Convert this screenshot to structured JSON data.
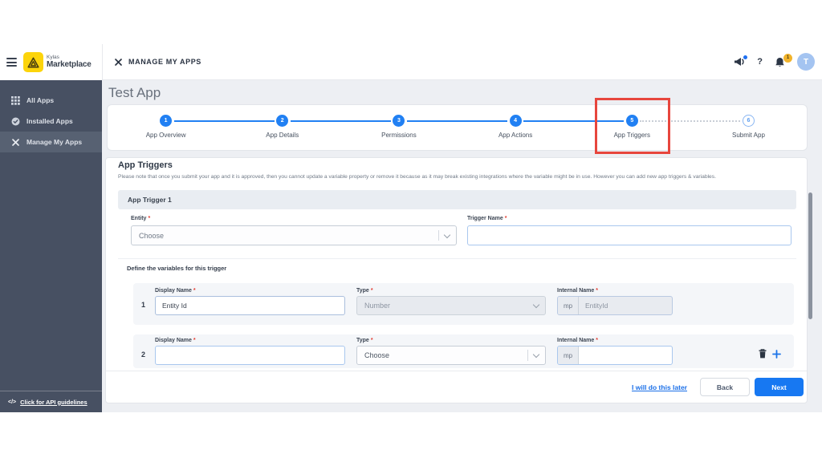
{
  "colors": {
    "accent_blue": "#2180f3",
    "button_blue": "#1778f2",
    "annotation_red": "#e7463d",
    "logo_yellow": "#fcd40b",
    "badge_yellow": "#f1b32b",
    "sidebar_bg": "#475062"
  },
  "sidebar": {
    "brand_top": "Kylas",
    "brand_bottom": "Marketplace",
    "items": [
      {
        "label": "All Apps"
      },
      {
        "label": "Installed Apps"
      },
      {
        "label": "Manage My Apps"
      }
    ],
    "api_link_icon": "</>",
    "api_link_label": "Click for API guidelines"
  },
  "topbar": {
    "title": "MANAGE MY APPS",
    "help_icon": "?",
    "notification_count": "1",
    "avatar_initial": "T"
  },
  "page": {
    "title": "Test App"
  },
  "stepper": {
    "steps": [
      {
        "number": "1",
        "label": "App Overview",
        "state": "complete"
      },
      {
        "number": "2",
        "label": "App Details",
        "state": "complete"
      },
      {
        "number": "3",
        "label": "Permissions",
        "state": "complete"
      },
      {
        "number": "4",
        "label": "App Actions",
        "state": "complete"
      },
      {
        "number": "5",
        "label": "App Triggers",
        "state": "current",
        "annotated": true
      },
      {
        "number": "6",
        "label": "Submit App",
        "state": "upcoming"
      }
    ]
  },
  "section": {
    "heading": "App Triggers",
    "note": "Please note that once you submit your app and it is approved, then you cannot update a variable property or remove it because as it may break existing integrations where the variable might be in use. However you can add new app triggers & variables."
  },
  "required_mark": "*",
  "trigger_card": {
    "title": "App Trigger 1",
    "entity_label": "Entity",
    "entity_value": "Choose",
    "trigger_name_label": "Trigger Name",
    "trigger_name_value": "",
    "variables_heading": "Define the variables for this trigger",
    "column_labels": {
      "display_name": "Display Name",
      "type": "Type",
      "internal_name": "Internal Name"
    },
    "prefix": "mp",
    "variables": [
      {
        "index": "1",
        "display_name": "Entity Id",
        "type": "Number",
        "internal_name": "EntityId",
        "state": "locked"
      },
      {
        "index": "2",
        "display_name": "",
        "type": "Choose",
        "internal_name": "",
        "state": "editable"
      }
    ]
  },
  "footer": {
    "later_link": "I will do this later",
    "back_label": "Back",
    "next_label": "Next"
  }
}
